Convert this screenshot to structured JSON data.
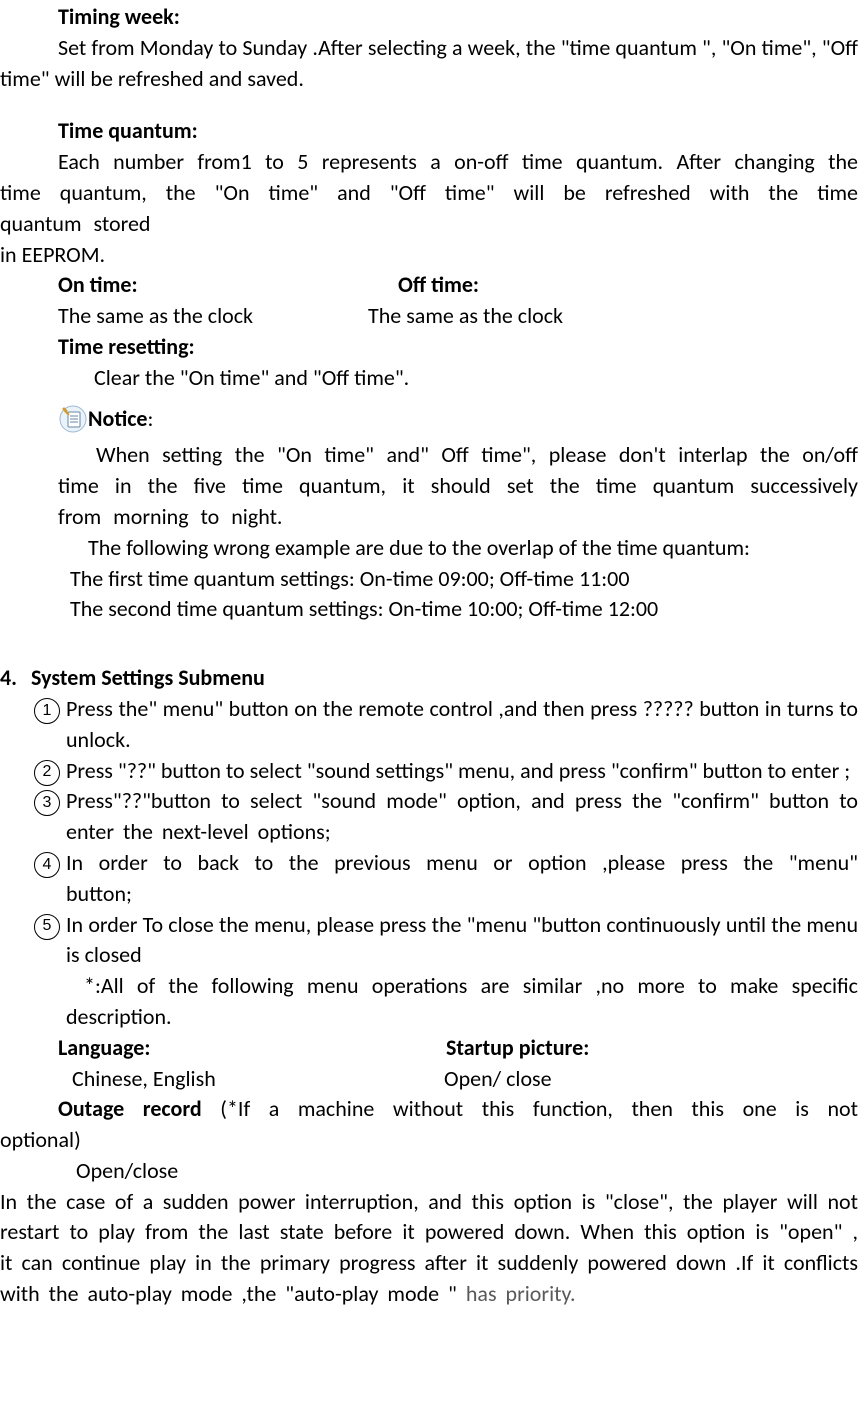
{
  "timing_week": {
    "heading": "Timing week:",
    "body": "Set from Monday to Sunday .After selecting a week, the \"time quantum \", \"On time\", \"Off time\" will be refreshed and saved."
  },
  "time_quantum": {
    "heading": "Time quantum:",
    "body_a": "Each number from1 to 5 represents a on-off time quantum. After changing the time  quantum,  the  \"On  time\"  and  \"Off  time\"  will  be  refreshed  with  the  time quantum stored",
    "body_b": "in EEPROM."
  },
  "on_time": {
    "heading": "On time:",
    "body": "The same as the clock"
  },
  "off_time": {
    "heading": "Off time:",
    "body": "The same as the clock"
  },
  "time_resetting": {
    "heading": "Time resetting:",
    "body": "Clear the \"On time\" and \"Off time\"."
  },
  "notice": {
    "label": "Notice",
    "colon": ":",
    "p1": "When  setting  the  \"On  time\"  and\"  Off  time\",  please  don't  interlap  the on/off  time  in  the  five  time  quantum,  it  should  set  the  time  quantum successively from morning to night.",
    "p2": "The following wrong example are due to the overlap of the time quantum:",
    "ex1": "The first time quantum settings:      On-time 09:00; Off-time 11:00",
    "ex2": "The second time quantum settings: On-time 10:00; Off-time 12:00"
  },
  "section4": {
    "num": "4.",
    "title": "System Settings Submenu",
    "items": [
      "Press the\" menu\" button on the remote control ,and then press ????? button in turns to unlock.",
      "Press \"??\" button to select \"sound settings\" menu, and press \"confirm\" button to enter ;",
      "Press\"??\"button  to  select  \"sound  mode\"  option,  and  press  the  \"confirm\" button to enter the next-level options;",
      "In  order  to  back  to  the  previous  menu  or  option  ,please  press  the  \"menu\" button;",
      "In order To close the menu, please press the \"menu \"button continuously until the menu is closed"
    ],
    "note": "*:All of the following menu operations are similar ,no more to make specific description.",
    "language": {
      "heading": "Language:",
      "body": "Chinese, English"
    },
    "startup": {
      "heading": "Startup picture:",
      "body": "Open/ close"
    },
    "outage": {
      "label_a": "Outage  record",
      "label_b": "  (*If  a  machine  without  this  function,  then  this  one  is  not optional)",
      "body": "Open/close",
      "desc_a": "  In the case of a sudden power interruption, and this option is \"close\", the player will not restart to play from the last state before it powered down. When this option is \"open\"  ,  it  can  continue  play  in  the  primary  progress  after  it  suddenly  powered down .If it conflicts with the auto-play mode ,the \"auto-play mode \" ",
      "desc_b": "has priority."
    }
  }
}
